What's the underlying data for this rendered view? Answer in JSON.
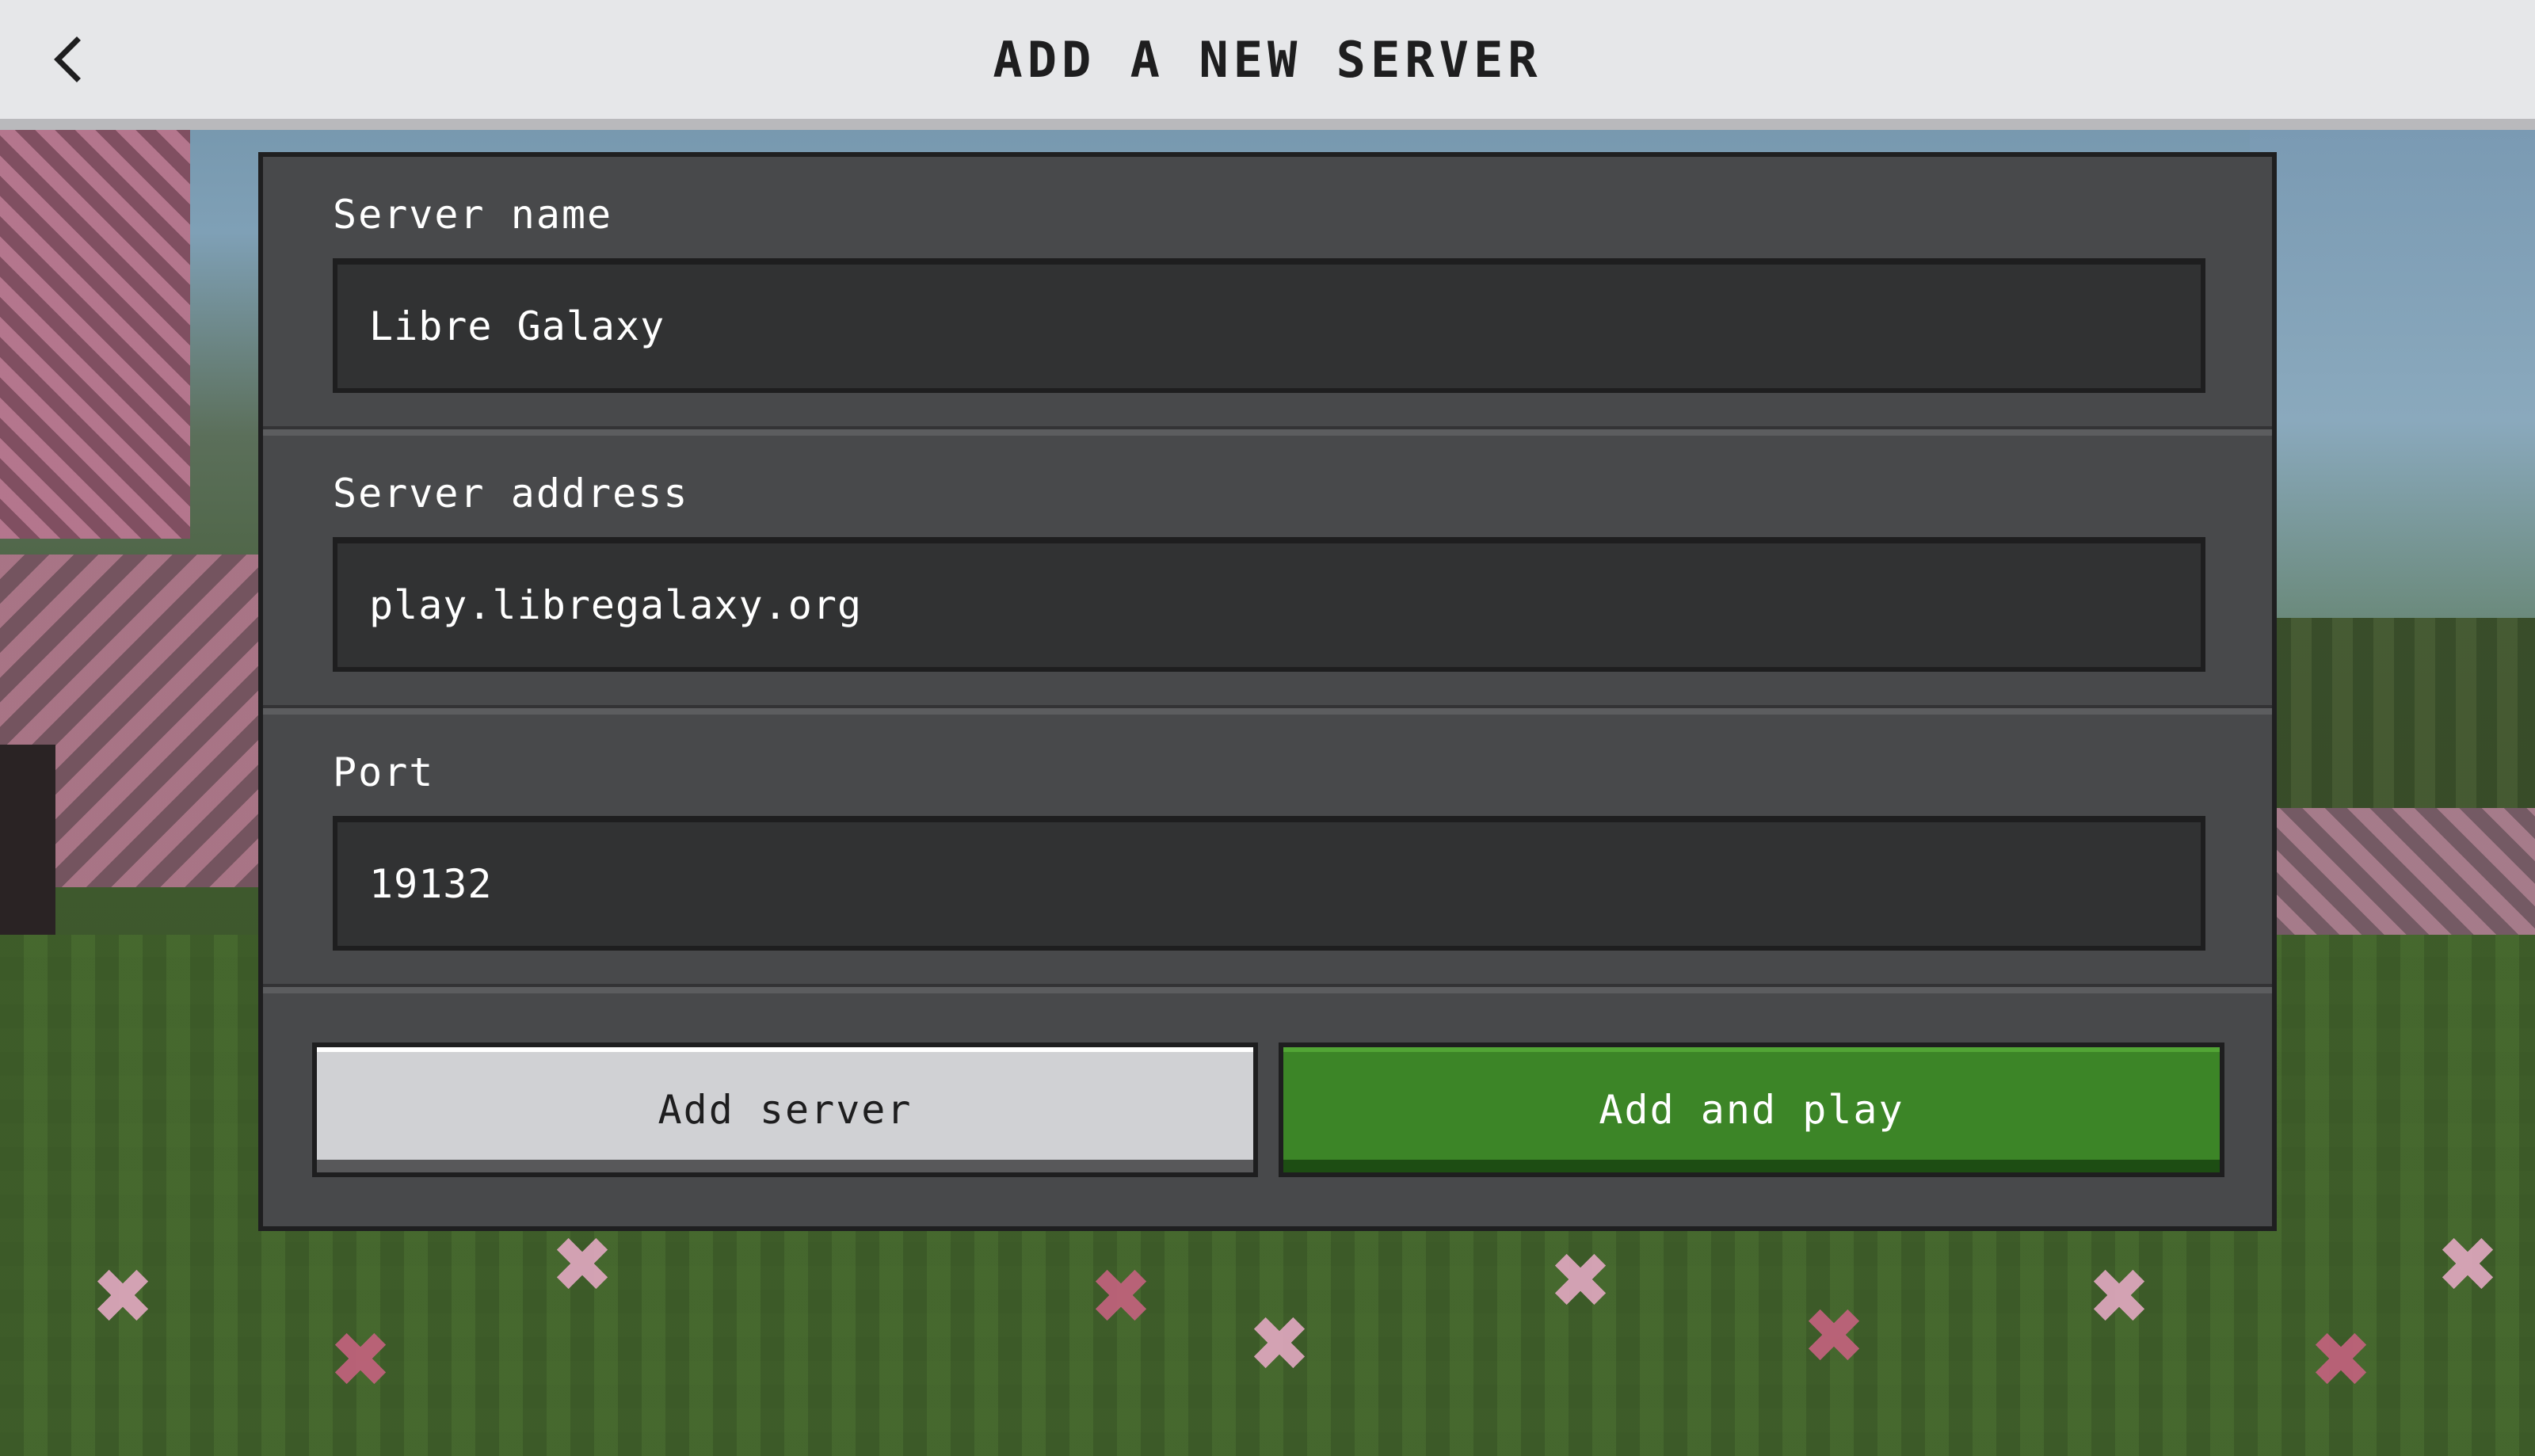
{
  "header": {
    "title": "ADD A NEW SERVER",
    "back_icon": "chevron-left-icon"
  },
  "form": {
    "server_name": {
      "label": "Server name",
      "value": "Libre Galaxy"
    },
    "server_address": {
      "label": "Server address",
      "value": "play.libregalaxy.org"
    },
    "port": {
      "label": "Port",
      "value": "19132"
    }
  },
  "actions": {
    "add_server_label": "Add server",
    "add_and_play_label": "Add and play"
  },
  "colors": {
    "header_bg": "#e6e7e9",
    "panel_bg": "#48494b",
    "input_bg": "#313233",
    "secondary_button": "#d0d1d4",
    "primary_button": "#3c8527"
  }
}
